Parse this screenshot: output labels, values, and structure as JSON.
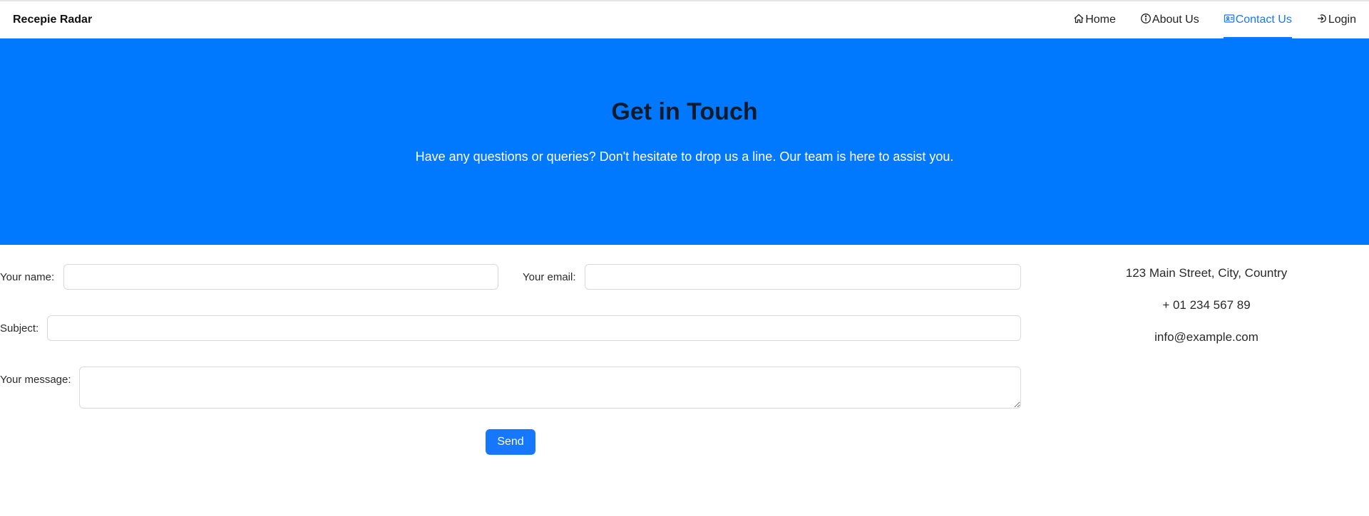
{
  "brand": "Recepie Radar",
  "nav": {
    "items": [
      {
        "label": "Home",
        "icon": "home-icon"
      },
      {
        "label": "About Us",
        "icon": "info-icon"
      },
      {
        "label": "Contact Us",
        "icon": "contact-card-icon",
        "active": true
      },
      {
        "label": "Login",
        "icon": "login-icon"
      }
    ]
  },
  "hero": {
    "title": "Get in Touch",
    "subtitle": "Have any questions or queries? Don't hesitate to drop us a line. Our team is here to assist you."
  },
  "form": {
    "name_label": "Your name",
    "name_value": "",
    "email_label": "Your email",
    "email_value": "",
    "subject_label": "Subject",
    "subject_value": "",
    "message_label": "Your message",
    "message_value": "",
    "send_label": "Send"
  },
  "contact": {
    "address": "123 Main Street, City, Country",
    "phone": "+ 01 234 567 89",
    "email": "info@example.com"
  },
  "colors": {
    "primary": "#1677ff",
    "hero_background": "#0079ff"
  }
}
